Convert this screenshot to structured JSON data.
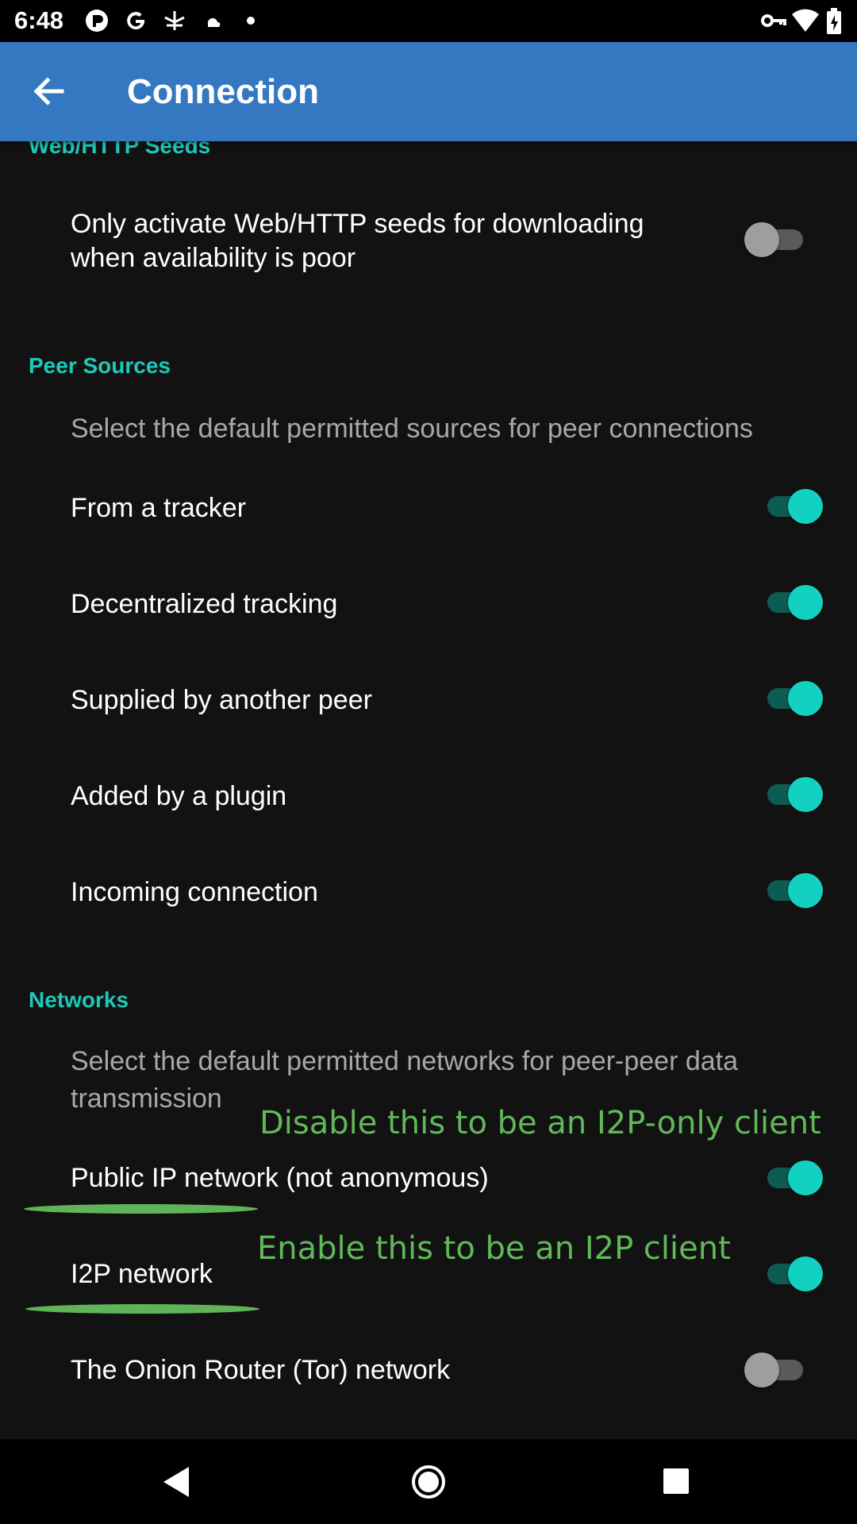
{
  "status_bar": {
    "time": "6:48",
    "left_icons": [
      "pocket-icon",
      "google-icon",
      "signal-icon",
      "cloud-icon",
      "dot-icon"
    ],
    "right_icons": [
      "vpn-key-icon",
      "wifi-icon",
      "battery-icon"
    ]
  },
  "app_bar": {
    "title": "Connection",
    "back_icon": "arrow-back-icon",
    "color": "#3478c1"
  },
  "sections": {
    "web_seeds": {
      "header": "Web/HTTP Seeds",
      "items": [
        {
          "title": "Only activate Web/HTTP seeds for downloading when availability is poor",
          "enabled": false
        }
      ]
    },
    "peer_sources": {
      "header": "Peer Sources",
      "summary": "Select the default permitted sources for peer connections",
      "items": [
        {
          "title": "From a tracker",
          "enabled": true
        },
        {
          "title": "Decentralized tracking",
          "enabled": true
        },
        {
          "title": "Supplied by another peer",
          "enabled": true
        },
        {
          "title": "Added by a plugin",
          "enabled": true
        },
        {
          "title": "Incoming connection",
          "enabled": true
        }
      ]
    },
    "networks": {
      "header": "Networks",
      "summary": "Select the default permitted networks for peer-peer data transmission",
      "items": [
        {
          "title": "Public IP network (not anonymous)",
          "enabled": true
        },
        {
          "title": "I2P network",
          "enabled": true
        },
        {
          "title": "The Onion Router (Tor) network",
          "enabled": false
        }
      ]
    }
  },
  "annotations": {
    "public_ip": "Disable this to be an I2P-only client",
    "i2p": "Enable this to be an I2P client"
  },
  "colors": {
    "accent": "#1fc8b8",
    "switch_on": "#13d1c0",
    "annotation": "#61b85a",
    "background": "#121212"
  },
  "nav_bar": {
    "icons": [
      "nav-back-icon",
      "nav-home-icon",
      "nav-recents-icon"
    ]
  }
}
